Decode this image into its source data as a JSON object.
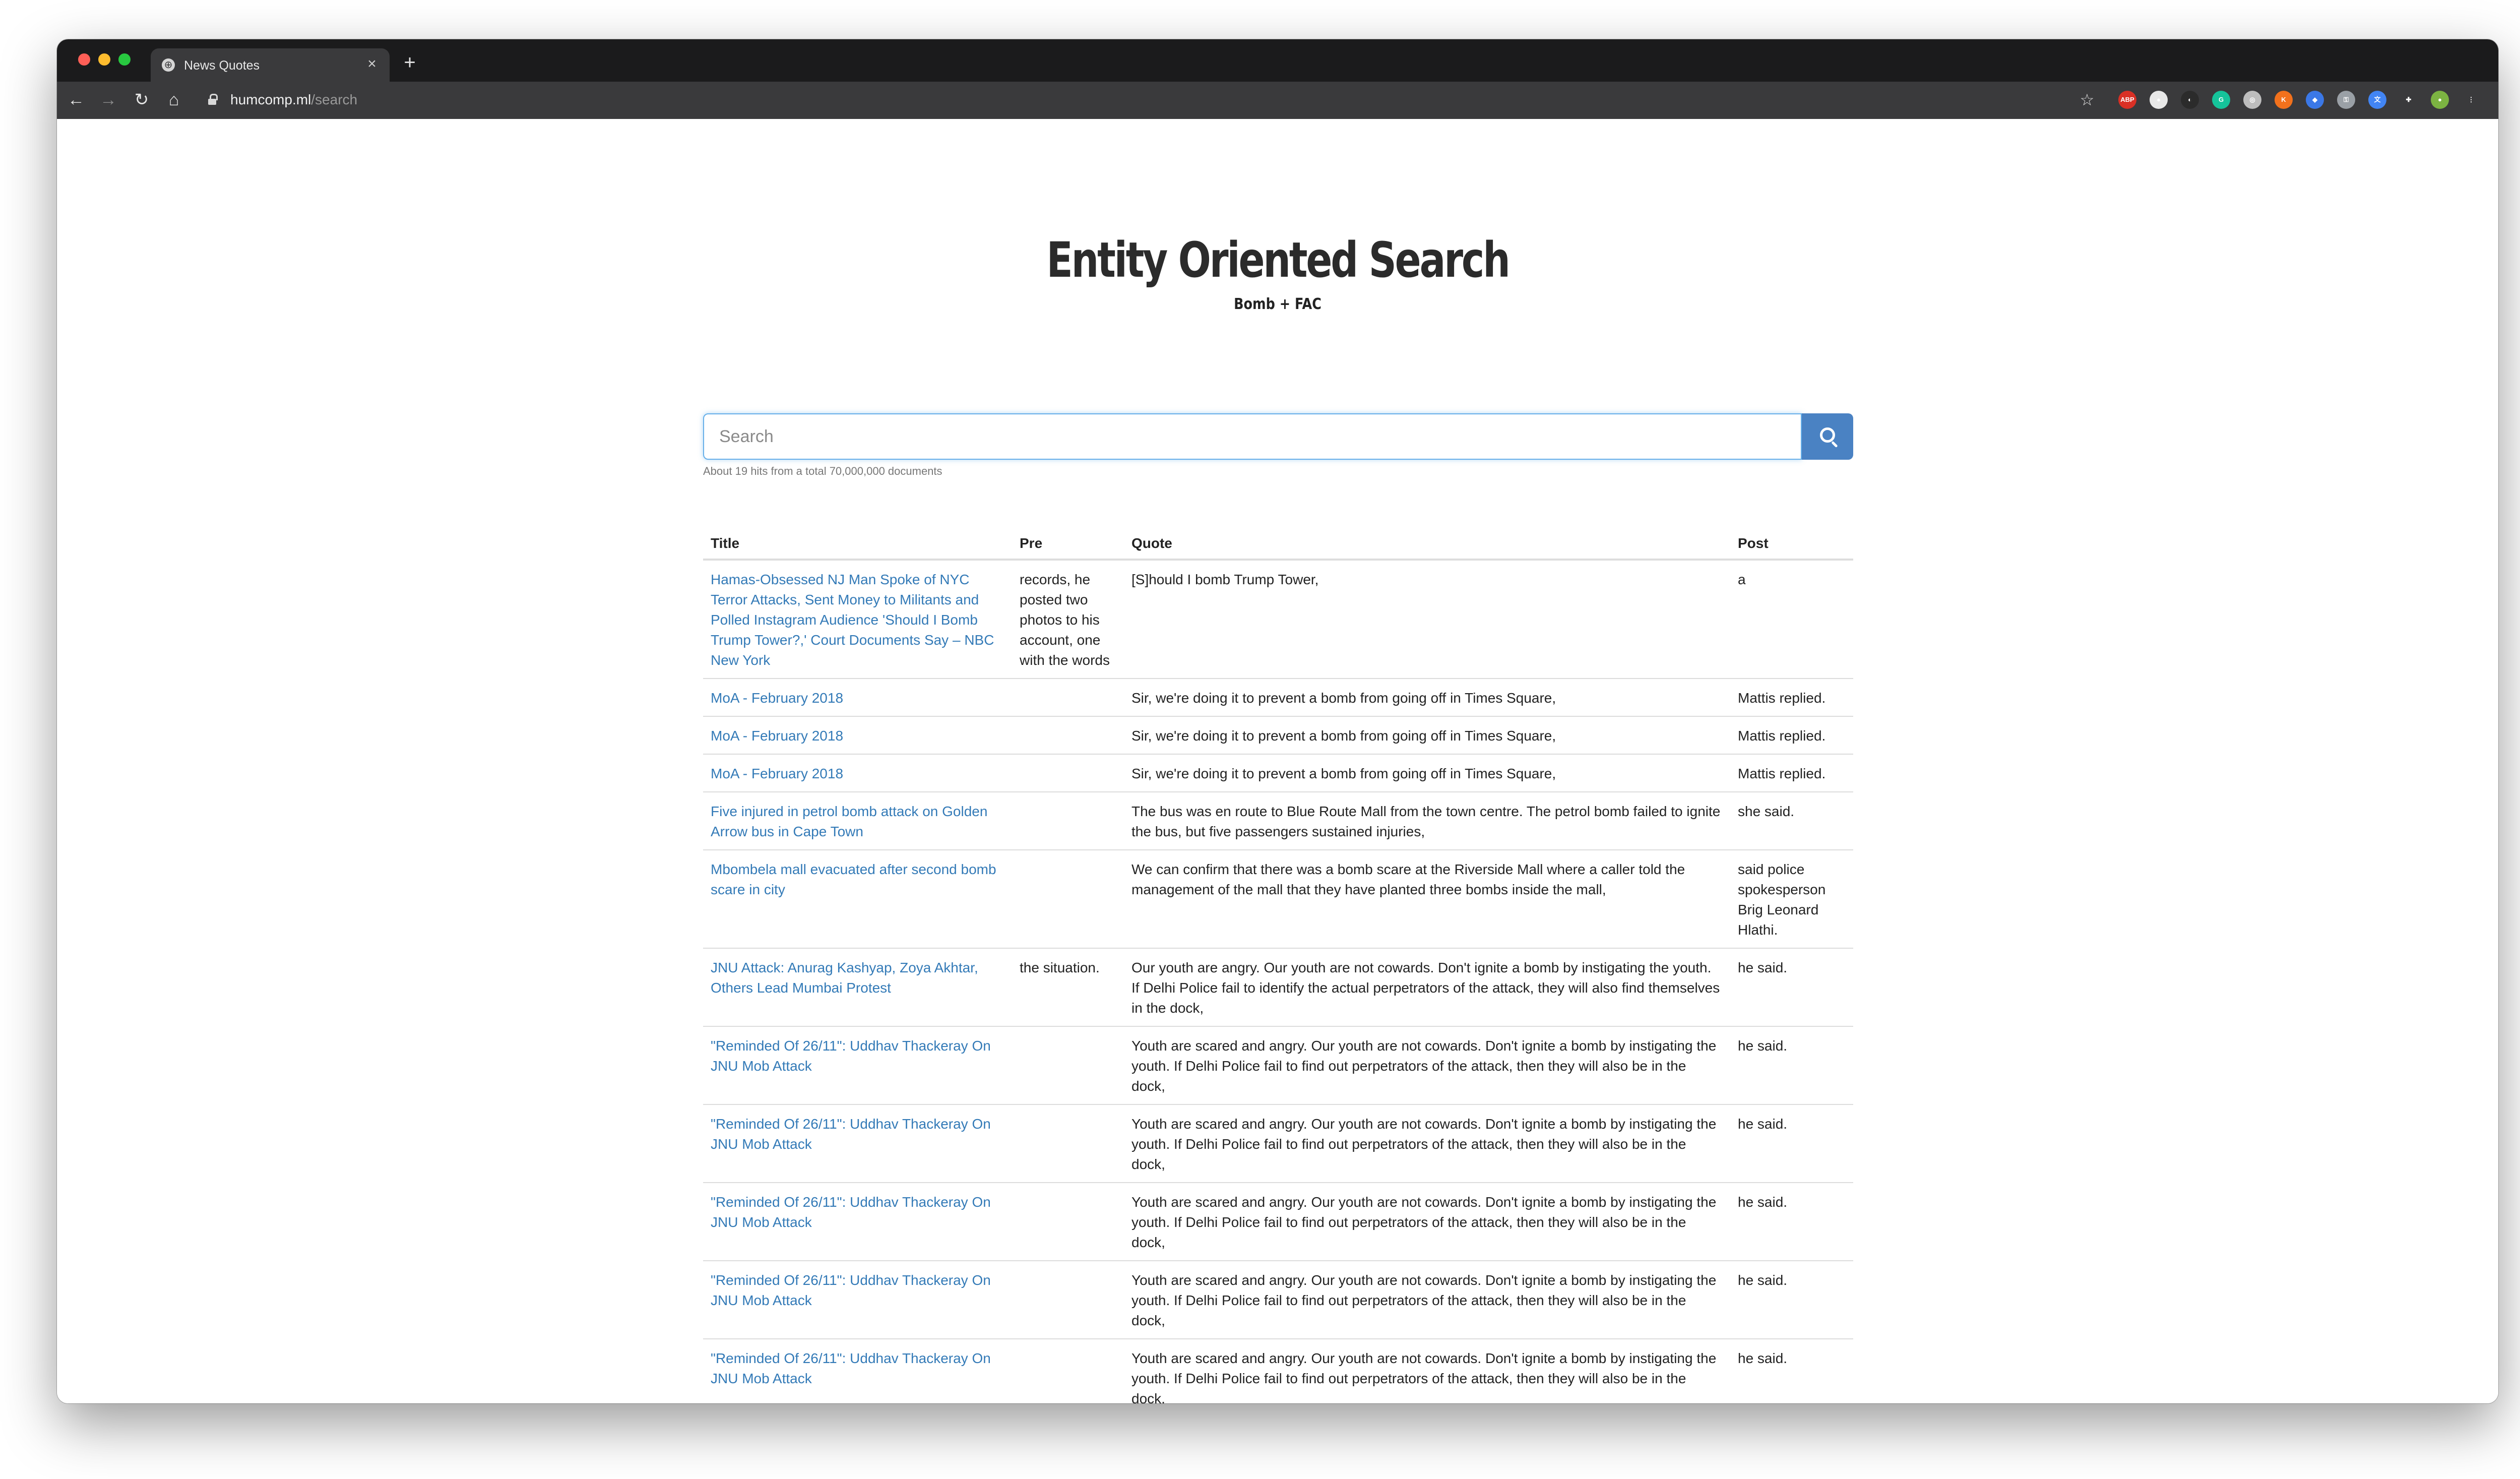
{
  "browser": {
    "tab_title": "News Quotes",
    "tab_close": "×",
    "new_tab": "+",
    "url_host": "humcomp.ml",
    "url_path": "/search"
  },
  "page": {
    "title": "Entity Oriented Search",
    "subtitle": "Bomb + FAC"
  },
  "search": {
    "placeholder": "Search",
    "hits_text": "About 19 hits from a total 70,000,000 documents"
  },
  "table": {
    "headers": [
      "Title",
      "Pre",
      "Quote",
      "Post"
    ],
    "rows": [
      {
        "title": "Hamas-Obsessed NJ Man Spoke of NYC Terror Attacks, Sent Money to Militants and Polled Instagram Audience 'Should I Bomb Trump Tower?,' Court Documents Say – NBC New York",
        "pre": "records, he posted two photos to his account, one with the words",
        "quote": "[S]hould I bomb Trump Tower,",
        "post": "a"
      },
      {
        "title": "MoA - February 2018",
        "pre": "",
        "quote": "Sir, we're doing it to prevent a bomb from going off in Times Square,",
        "post": "Mattis replied."
      },
      {
        "title": "MoA - February 2018",
        "pre": "",
        "quote": "Sir, we're doing it to prevent a bomb from going off in Times Square,",
        "post": "Mattis replied."
      },
      {
        "title": "MoA - February 2018",
        "pre": "",
        "quote": "Sir, we're doing it to prevent a bomb from going off in Times Square,",
        "post": "Mattis replied."
      },
      {
        "title": "Five injured in petrol bomb attack on Golden Arrow bus in Cape Town",
        "pre": "",
        "quote": "The bus was en route to Blue Route Mall from the town centre. The petrol bomb failed to ignite the bus, but five passengers sustained injuries,",
        "post": "she said."
      },
      {
        "title": "Mbombela mall evacuated after second bomb scare in city",
        "pre": "",
        "quote": "We can confirm that there was a bomb scare at the Riverside Mall where a caller told the management of the mall that they have planted three bombs inside the mall,",
        "post": "said police spokesperson Brig Leonard Hlathi."
      },
      {
        "title": "JNU Attack: Anurag Kashyap, Zoya Akhtar, Others Lead Mumbai Protest",
        "pre": "the situation.",
        "quote": "Our youth are angry. Our youth are not cowards. Don't ignite a bomb by instigating the youth. If Delhi Police fail to identify the actual perpetrators of the attack, they will also find themselves in the dock,",
        "post": "he said."
      },
      {
        "title": "\"Reminded Of 26/11\": Uddhav Thackeray On JNU Mob Attack",
        "pre": "",
        "quote": "Youth are scared and angry. Our youth are not cowards. Don't ignite a bomb by instigating the youth. If Delhi Police fail to find out perpetrators of the attack, then they will also be in the dock,",
        "post": "he said."
      },
      {
        "title": "\"Reminded Of 26/11\": Uddhav Thackeray On JNU Mob Attack",
        "pre": "",
        "quote": "Youth are scared and angry. Our youth are not cowards. Don't ignite a bomb by instigating the youth. If Delhi Police fail to find out perpetrators of the attack, then they will also be in the dock,",
        "post": "he said."
      },
      {
        "title": "\"Reminded Of 26/11\": Uddhav Thackeray On JNU Mob Attack",
        "pre": "",
        "quote": "Youth are scared and angry. Our youth are not cowards. Don't ignite a bomb by instigating the youth. If Delhi Police fail to find out perpetrators of the attack, then they will also be in the dock,",
        "post": "he said."
      },
      {
        "title": "\"Reminded Of 26/11\": Uddhav Thackeray On JNU Mob Attack",
        "pre": "",
        "quote": "Youth are scared and angry. Our youth are not cowards. Don't ignite a bomb by instigating the youth. If Delhi Police fail to find out perpetrators of the attack, then they will also be in the dock,",
        "post": "he said."
      },
      {
        "title": "\"Reminded Of 26/11\": Uddhav Thackeray On JNU Mob Attack",
        "pre": "",
        "quote": "Youth are scared and angry. Our youth are not cowards. Don't ignite a bomb by instigating the youth. If Delhi Police fail to find out perpetrators of the attack, then they will also be in the dock,",
        "post": "he said."
      }
    ]
  },
  "icons": {
    "extensions": [
      {
        "name": "adblock-icon",
        "color": "#d93025",
        "glyph": "ABP"
      },
      {
        "name": "circle-white-icon",
        "color": "#e8e8e8",
        "glyph": "●"
      },
      {
        "name": "dark-extension-icon",
        "color": "#2b2b2b",
        "glyph": "◐"
      },
      {
        "name": "grammarly-icon",
        "color": "#15c39a",
        "glyph": "G"
      },
      {
        "name": "gray-circle-icon",
        "color": "#bdbdbd",
        "glyph": "◎"
      },
      {
        "name": "orange-extension-icon",
        "color": "#f2711c",
        "glyph": "K"
      },
      {
        "name": "blue-extension-icon",
        "color": "#3b78e7",
        "glyph": "◆"
      },
      {
        "name": "key-icon",
        "color": "#9aa0a6",
        "glyph": "⚿"
      },
      {
        "name": "translate-icon",
        "color": "#4285f4",
        "glyph": "文"
      },
      {
        "name": "puzzle-icon",
        "color": "#3a3a3c",
        "glyph": "✚"
      },
      {
        "name": "profile-avatar-icon",
        "color": "#7cb342",
        "glyph": "●"
      },
      {
        "name": "menu-icon",
        "color": "#3a3a3c",
        "glyph": "⋮"
      }
    ]
  }
}
